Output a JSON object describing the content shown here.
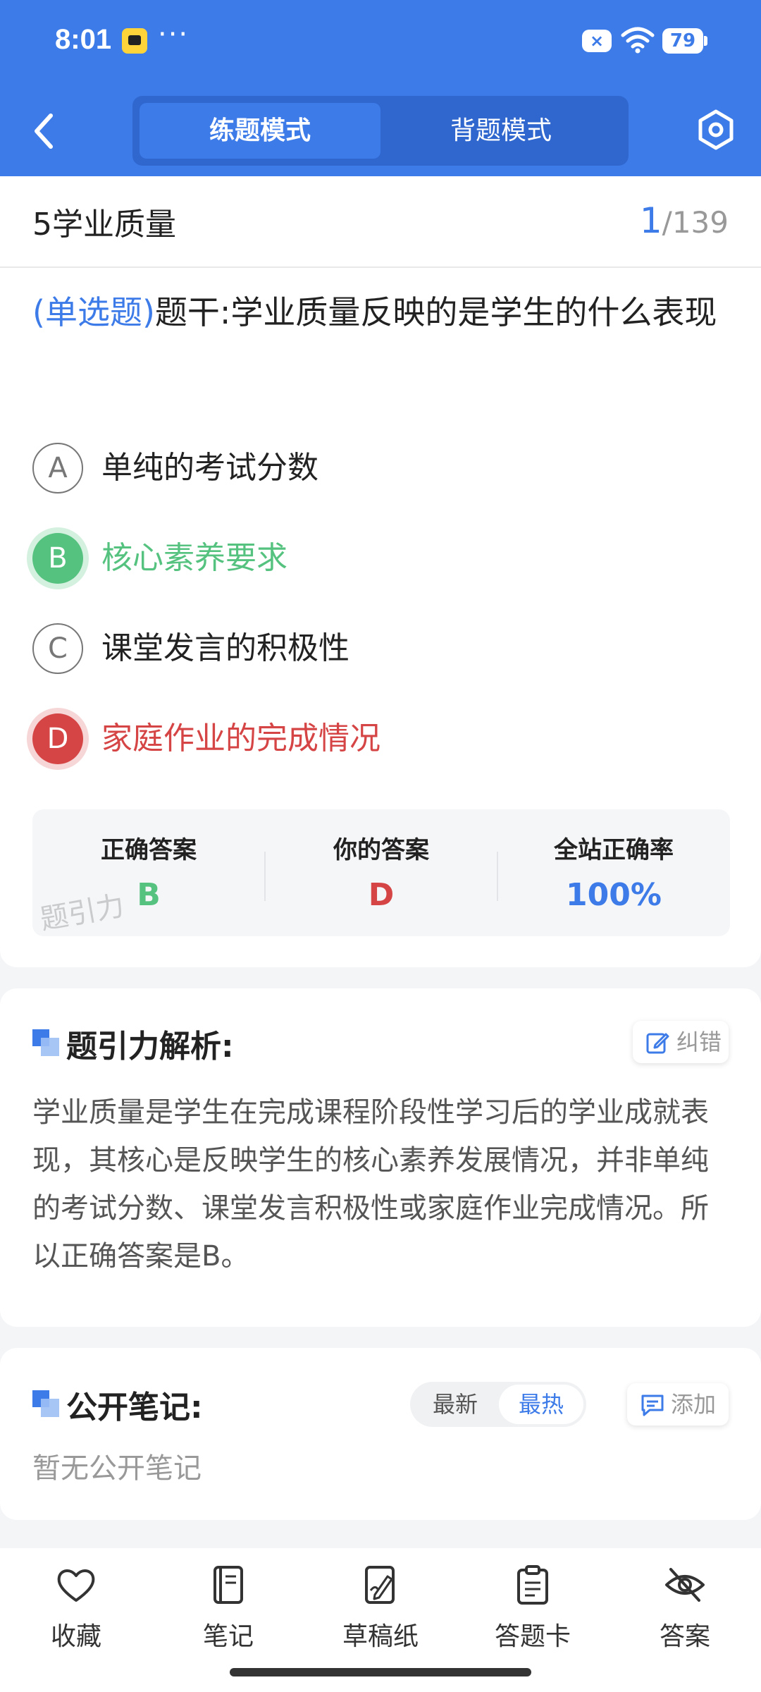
{
  "status_bar": {
    "time": "8:01",
    "more": "···",
    "battery": "79",
    "notification_badge": "×"
  },
  "header": {
    "modes": [
      "练题模式",
      "背题模式"
    ],
    "active_mode": "练题模式"
  },
  "question": {
    "section": "5学业质量",
    "progress_current": "1",
    "progress_total": "/139",
    "type": "(单选题)",
    "stem": "题干:学业质量反映的是学生的什么表现",
    "options": [
      {
        "letter": "A",
        "text": "单纯的考试分数",
        "state": "normal"
      },
      {
        "letter": "B",
        "text": "核心素养要求",
        "state": "correct"
      },
      {
        "letter": "C",
        "text": "课堂发言的积极性",
        "state": "normal"
      },
      {
        "letter": "D",
        "text": "家庭作业的完成情况",
        "state": "wrong"
      }
    ]
  },
  "result": {
    "correct_label": "正确答案",
    "correct_value": "B",
    "yours_label": "你的答案",
    "yours_value": "D",
    "rate_label": "全站正确率",
    "rate_value": "100%",
    "watermark": "题引力"
  },
  "analysis": {
    "title": "题引力解析:",
    "report_label": "纠错",
    "text": "学业质量是学生在完成课程阶段性学习后的学业成就表现，其核心是反映学生的核心素养发展情况，并非单纯的考试分数、课堂发言积极性或家庭作业完成情况。所以正确答案是B。"
  },
  "notes": {
    "title": "公开笔记:",
    "sort_latest": "最新",
    "sort_hot": "最热",
    "add_label": "添加",
    "empty_text": "暂无公开笔记"
  },
  "bottom_nav": [
    {
      "label": "收藏",
      "icon": "heart-icon"
    },
    {
      "label": "笔记",
      "icon": "notebook-icon"
    },
    {
      "label": "草稿纸",
      "icon": "draft-pen-icon"
    },
    {
      "label": "答题卡",
      "icon": "clipboard-icon"
    },
    {
      "label": "答案",
      "icon": "eye-off-icon"
    }
  ],
  "colors": {
    "primary": "#3d7be8",
    "correct": "#55c27f",
    "wrong": "#d64545"
  }
}
